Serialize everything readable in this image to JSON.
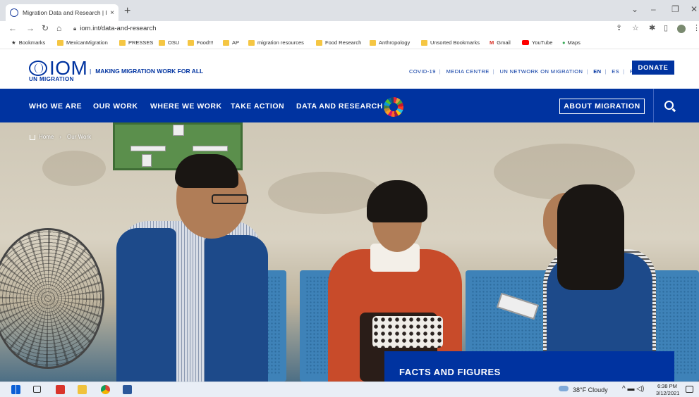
{
  "browser": {
    "tab_title": "Migration Data and Research | IO",
    "tab_close": "×",
    "new_tab": "+",
    "url": "iom.int/data-and-research",
    "bookmarks": [
      {
        "label": "Bookmarks",
        "type": "star"
      },
      {
        "label": "MexicanMigration",
        "type": "folder"
      },
      {
        "label": "PRESSES",
        "type": "folder"
      },
      {
        "label": "OSU",
        "type": "folder"
      },
      {
        "label": "Food!!!",
        "type": "folder"
      },
      {
        "label": "AP",
        "type": "folder"
      },
      {
        "label": "migration resources",
        "type": "folder"
      },
      {
        "label": "Food Research",
        "type": "folder"
      },
      {
        "label": "Anthropology",
        "type": "folder"
      },
      {
        "label": "Unsorted Bookmarks",
        "type": "folder"
      },
      {
        "label": "Gmail",
        "type": "gmail"
      },
      {
        "label": "YouTube",
        "type": "youtube"
      },
      {
        "label": "Maps",
        "type": "maps"
      }
    ]
  },
  "header": {
    "logo_text": "IOM",
    "logo_sub": "UN MIGRATION",
    "tagline": "MAKING MIGRATION WORK FOR ALL",
    "top_links": [
      "COVID-19",
      "MEDIA CENTRE",
      "UN NETWORK ON MIGRATION",
      "EN",
      "ES",
      "FR"
    ],
    "donate": "DONATE"
  },
  "nav": {
    "items": [
      "WHO WE ARE",
      "OUR WORK",
      "WHERE WE WORK",
      "TAKE ACTION",
      "DATA AND RESEARCH"
    ],
    "about": "ABOUT MIGRATION"
  },
  "hero": {
    "breadcrumb": [
      "Home",
      "Our Work"
    ],
    "facts_label": "FACTS AND FIGURES"
  },
  "taskbar": {
    "weather": "38°F Cloudy",
    "time": "6:38 PM",
    "date": "3/12/2021"
  },
  "colors": {
    "brand": "#0033a0",
    "tab_bg": "#dee1e6"
  }
}
